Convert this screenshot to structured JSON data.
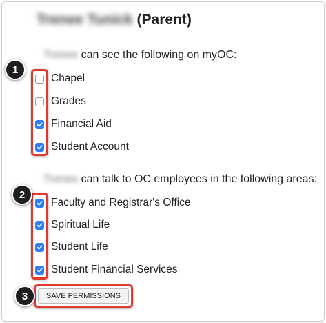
{
  "header": {
    "person_name": "Trenee Tunick",
    "role_suffix": "(Parent)"
  },
  "see_section": {
    "student_name": "Trenee",
    "text": "can see the following on myOC:",
    "items": [
      {
        "label": "Chapel",
        "checked": false
      },
      {
        "label": "Grades",
        "checked": false
      },
      {
        "label": "Financial Aid",
        "checked": true
      },
      {
        "label": "Student Account",
        "checked": true
      }
    ]
  },
  "talk_section": {
    "student_name": "Trenee",
    "text": "can talk to OC employees in the following areas:",
    "items": [
      {
        "label": "Faculty and Registrar's Office",
        "checked": true
      },
      {
        "label": "Spiritual Life",
        "checked": true
      },
      {
        "label": "Student Life",
        "checked": true
      },
      {
        "label": "Student Financial Services",
        "checked": true
      }
    ]
  },
  "save_button": {
    "label": "SAVE PERMISSIONS"
  },
  "callouts": [
    "1",
    "2",
    "3"
  ],
  "colors": {
    "checkbox_checked": "#2f7ff2",
    "callout_border": "#e03a2f",
    "badge_bg": "#1e1e1e"
  }
}
